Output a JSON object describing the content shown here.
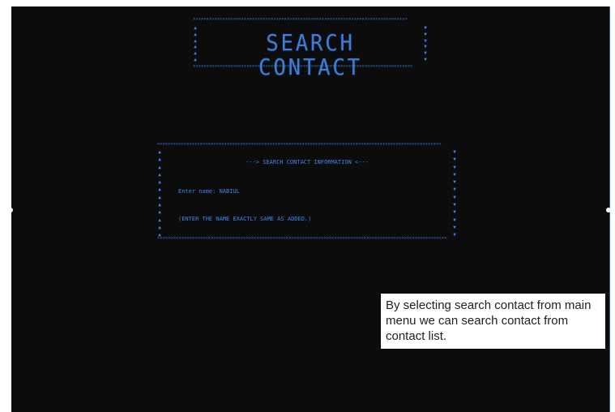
{
  "title": {
    "text": "SEARCH CONTACT"
  },
  "info_box": {
    "heading": "---> SEARCH CONTACT INFORMATION <---",
    "prompt_label": "Enter name:",
    "prompt_value": "NABIUL",
    "note": "(ENTER THE NAME EXACTLY SAME AS ADDED.)"
  },
  "caption": {
    "text": "By selecting search contact from main menu we can search  contact from contact list."
  },
  "colors": {
    "background": "#0c0c0d",
    "accent": "#3f86e8",
    "caption_bg": "#ffffff",
    "caption_text": "#222222"
  },
  "icons": {
    "border_horizontal": "greater-than-chevrons",
    "border_vertical_left": "up-triangle",
    "border_vertical_right": "down-triangle"
  }
}
